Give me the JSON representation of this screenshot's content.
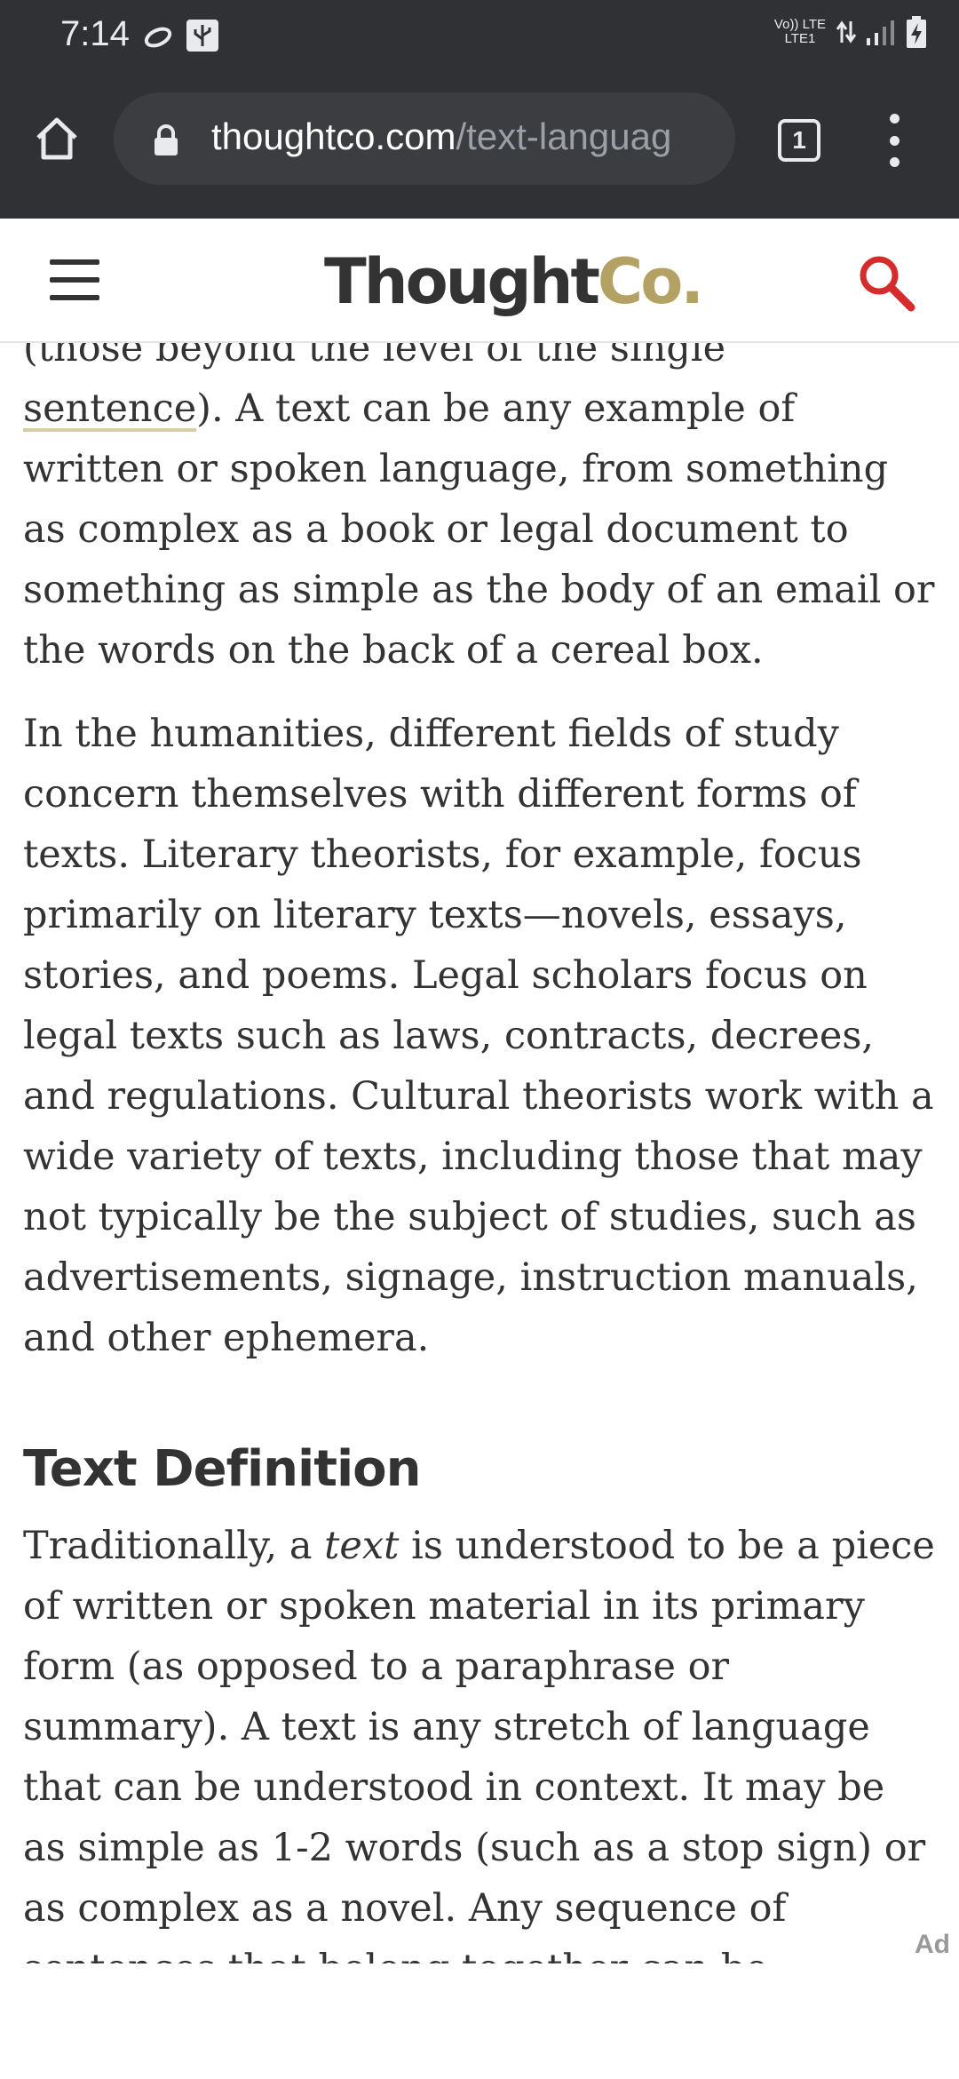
{
  "status_bar": {
    "time": "7:14",
    "network_top": "Vo)) LTE",
    "network_bottom": "LTE1",
    "icons": [
      "sync-icon",
      "usb-icon",
      "arrows-icon",
      "signal-icon",
      "battery-charging-icon"
    ]
  },
  "browser": {
    "url_domain": "thoughtco.com",
    "url_path": "/text-languag",
    "tab_count": "1"
  },
  "site": {
    "logo_main": "Thought",
    "logo_accent": "Co."
  },
  "article": {
    "para1_cut_line": "(those beyond the level of the single",
    "para1_link": "sentence",
    "para1_rest": "). A text can be any example of written or spoken language, from something as complex as a book or legal document to something as simple as the body of an email or the words on the back of a cereal box.",
    "para2": "In the humanities, different fields of study concern themselves with different forms of texts. Literary theorists, for example, focus primarily on literary texts—novels, essays, stories, and poems. Legal scholars focus on legal texts such as laws, contracts, decrees, and regulations. Cultural theorists work with a wide variety of texts, including those that may not typically be the subject of studies, such as advertisements, signage, instruction manuals, and other ephemera.",
    "heading": "Text Definition",
    "para3_before": "Traditionally, a ",
    "para3_italic": "text",
    "para3_after": " is understood to be a piece of written or spoken material in its primary form (as opposed to a paraphrase or summary). A text is any stretch of language that can be understood in context. It may be as simple as 1-2 words (such as a stop sign) or as complex as a novel. Any sequence of sentences that belong together can be considered"
  },
  "ad_label": "Ad"
}
